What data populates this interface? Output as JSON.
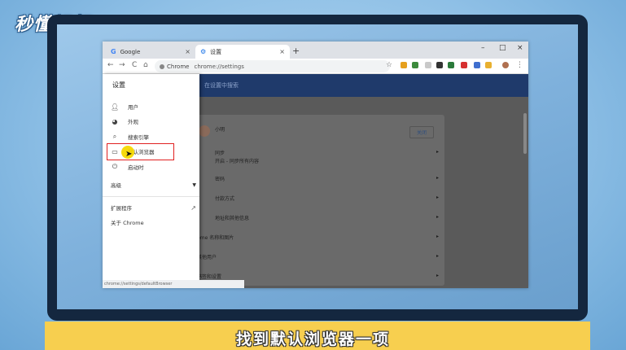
{
  "logo": {
    "text": "秒懂视频"
  },
  "browser": {
    "tabs": [
      {
        "label": "Google",
        "icon": "google-icon",
        "close": "×"
      },
      {
        "label": "设置",
        "icon": "gear-icon",
        "close": "×"
      }
    ],
    "new_tab": "+",
    "window_controls": {
      "minimize": "–",
      "maximize": "□",
      "close": "×"
    },
    "nav": {
      "back": "←",
      "forward": "→",
      "reload": "C",
      "home": "⌂"
    },
    "omnibox": {
      "chip": "Chrome",
      "url": "chrome://settings"
    },
    "status_url": "chrome://settings/defaultBrowser"
  },
  "settings": {
    "search_placeholder": "在设置中搜索",
    "profile": {
      "name": "小明",
      "close_label": "关闭"
    },
    "rows": [
      {
        "label": "同步",
        "sub": "开启 - 同步所有内容"
      },
      {
        "label": "密码"
      },
      {
        "label": "付款方式"
      },
      {
        "label": "地址和其他信息"
      },
      {
        "label": "hrome 名称和图片"
      },
      {
        "label": "理其他用户"
      },
      {
        "label": "入书签和设置"
      }
    ]
  },
  "drawer": {
    "title": "设置",
    "items": [
      {
        "label": "用户",
        "icon": "person-icon"
      },
      {
        "label": "外观",
        "icon": "palette-icon"
      },
      {
        "label": "搜索引擎",
        "icon": "search-icon"
      },
      {
        "label": "默认浏览器",
        "icon": "browser-icon"
      },
      {
        "label": "启动时",
        "icon": "power-icon"
      }
    ],
    "advanced": "高级",
    "extensions": "扩展程序",
    "about": "关于 Chrome"
  },
  "caption": {
    "text": "找到默认浏览器一项"
  }
}
